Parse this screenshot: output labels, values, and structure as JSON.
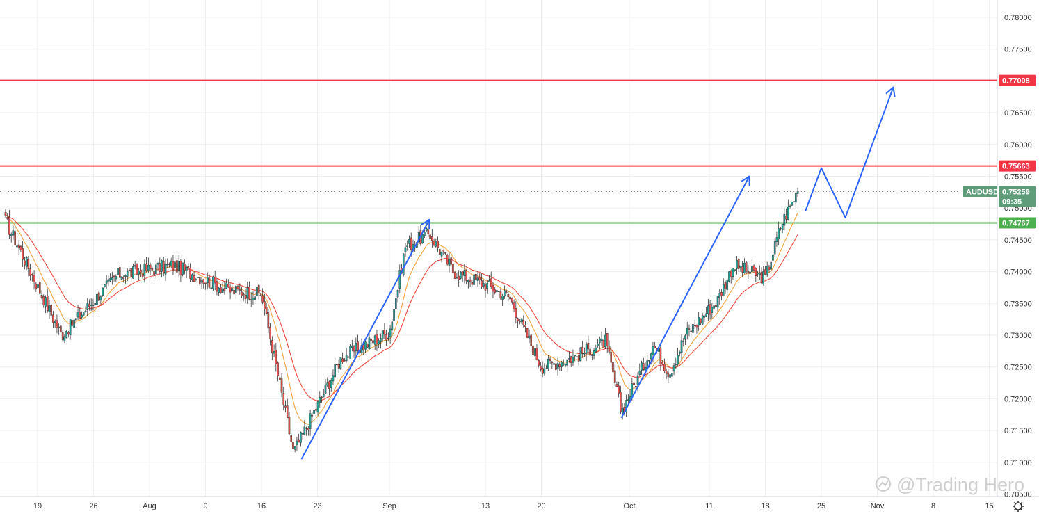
{
  "chart_data": {
    "type": "candlestick",
    "symbol": "AUDUSD",
    "last_price": "0.75259",
    "countdown": "09:35",
    "y_axis": {
      "ylim": [
        0.7048,
        0.7835
      ],
      "ticks": [
        "0.78000",
        "0.77500",
        "0.77000",
        "0.76500",
        "0.76000",
        "0.75500",
        "0.75000",
        "0.74500",
        "0.74000",
        "0.73500",
        "0.73000",
        "0.72500",
        "0.72000",
        "0.71500",
        "0.71000",
        "0.70500"
      ]
    },
    "x_axis": {
      "ticks": [
        "19",
        "26",
        "Aug",
        "9",
        "16",
        "23",
        "Sep",
        "13",
        "20",
        "Oct",
        "11",
        "18",
        "25",
        "Nov",
        "8",
        "15"
      ]
    },
    "horizontal_levels": [
      {
        "price": 0.77008,
        "label": "0.77008",
        "color": "#f23645"
      },
      {
        "price": 0.75663,
        "label": "0.75663",
        "color": "#f23645"
      },
      {
        "price": 0.74767,
        "label": "0.74767",
        "color": "#4caf50"
      }
    ],
    "key_points": [
      {
        "date": "Jul 15",
        "price": 0.748
      },
      {
        "date": "Jul 22",
        "price": 0.73
      },
      {
        "date": "Jul 29",
        "price": 0.7395
      },
      {
        "date": "Aug 5",
        "price": 0.741
      },
      {
        "date": "Aug 12",
        "price": 0.737
      },
      {
        "date": "Aug 16",
        "price": 0.7365
      },
      {
        "date": "Aug 20",
        "price": 0.7115
      },
      {
        "date": "Aug 26",
        "price": 0.7265
      },
      {
        "date": "Sep 1",
        "price": 0.7305
      },
      {
        "date": "Sep 3",
        "price": 0.744
      },
      {
        "date": "Sep 6",
        "price": 0.746
      },
      {
        "date": "Sep 9",
        "price": 0.74
      },
      {
        "date": "Sep 13",
        "price": 0.738
      },
      {
        "date": "Sep 16",
        "price": 0.736
      },
      {
        "date": "Sep 20",
        "price": 0.725
      },
      {
        "date": "Sep 24",
        "price": 0.7265
      },
      {
        "date": "Sep 28",
        "price": 0.729
      },
      {
        "date": "Sep 30",
        "price": 0.718
      },
      {
        "date": "Oct 4",
        "price": 0.7285
      },
      {
        "date": "Oct 6",
        "price": 0.724
      },
      {
        "date": "Oct 8",
        "price": 0.73
      },
      {
        "date": "Oct 12",
        "price": 0.7355
      },
      {
        "date": "Oct 14",
        "price": 0.741
      },
      {
        "date": "Oct 18",
        "price": 0.739
      },
      {
        "date": "Oct 20",
        "price": 0.7475
      },
      {
        "date": "Oct 22",
        "price": 0.75259
      }
    ],
    "forecast_arrows": [
      [
        {
          "date": "Aug 21",
          "price": 0.7105
        },
        {
          "date": "Sep 6",
          "price": 0.7482
        }
      ],
      [
        {
          "date": "Sep 30",
          "price": 0.717
        },
        {
          "date": "Oct 16",
          "price": 0.755
        }
      ],
      [
        {
          "date": "Oct 23",
          "price": 0.7495
        },
        {
          "date": "Oct 25",
          "price": 0.7563
        },
        {
          "date": "Oct 28",
          "price": 0.7485
        },
        {
          "date": "Nov 3",
          "price": 0.769
        }
      ]
    ],
    "watermark": "@Trading Hero",
    "colors": {
      "up": "#26a69a",
      "down": "#ef5350",
      "ma_fast": "#f7a13b",
      "ma_slow": "#f0473b",
      "arrow": "#2962ff",
      "grid": "#eeeeee",
      "symbol_tag": "#5f9d7a"
    }
  }
}
